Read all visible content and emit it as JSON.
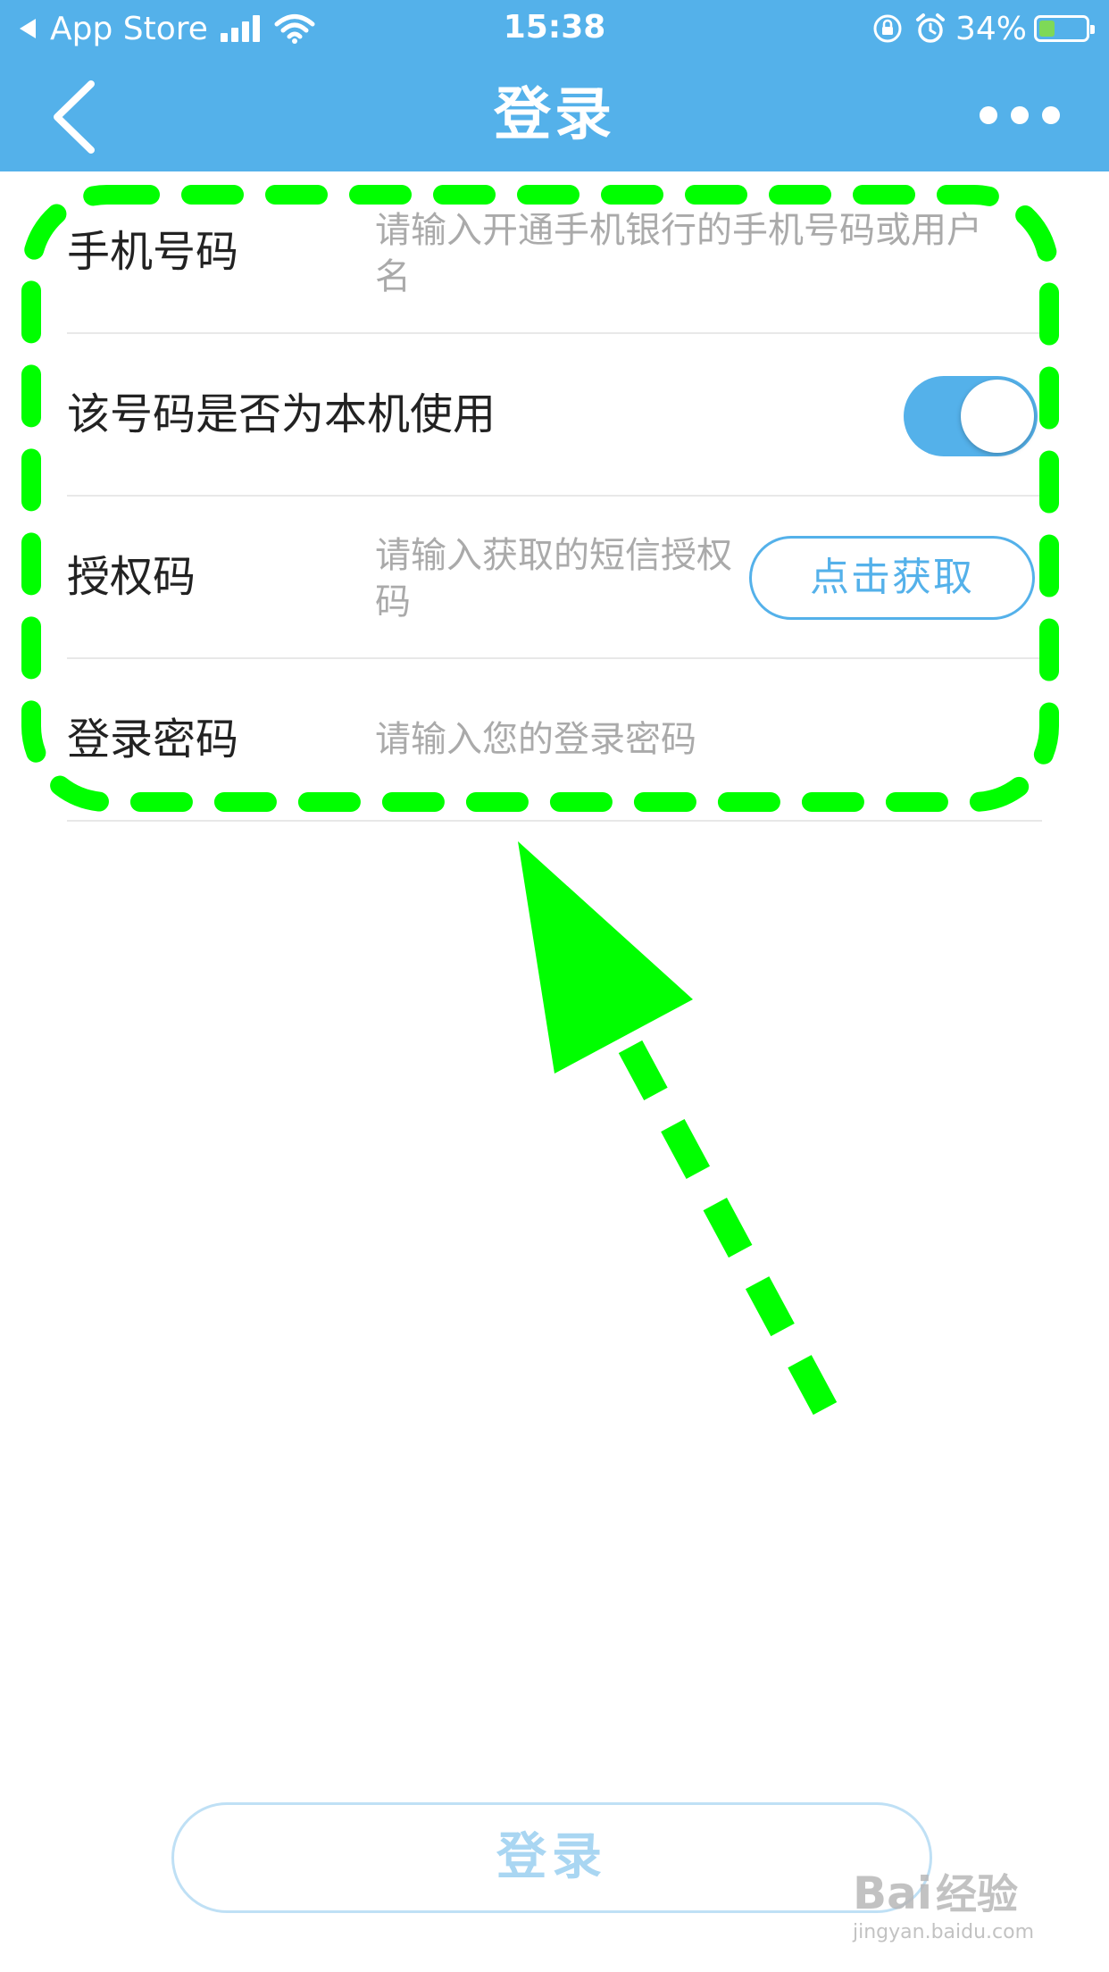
{
  "status_bar": {
    "carrier": "App Store",
    "time": "15:38",
    "battery_percent": "34%",
    "battery_level": 0.34,
    "icons": [
      "back-triangle-icon",
      "signal-icon",
      "wifi-icon",
      "rotation-lock-icon",
      "alarm-icon",
      "battery-icon"
    ]
  },
  "nav": {
    "title": "登录",
    "back_icon": "chevron-left-icon",
    "more_icon": "more-dots-icon"
  },
  "form": {
    "phone": {
      "label": "手机号码",
      "placeholder": "请输入开通手机银行的手机号码或用户名"
    },
    "own_device": {
      "label": "该号码是否为本机使用",
      "toggle_on": true
    },
    "auth_code": {
      "label": "授权码",
      "placeholder": "请输入获取的短信授权码",
      "button": "点击获取"
    },
    "password": {
      "label": "登录密码",
      "placeholder": "请输入您的登录密码"
    }
  },
  "login_button": "登录",
  "watermark": {
    "logo": "Bai",
    "logo_cn": "经验",
    "url": "jingyan.baidu.com"
  },
  "colors": {
    "brand_blue": "#54b1ea",
    "annotation_green": "#00ff00",
    "placeholder_gray": "#aaaaaa"
  }
}
